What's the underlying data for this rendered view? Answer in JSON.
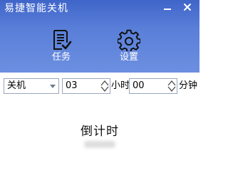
{
  "window": {
    "title": "易捷智能关机",
    "minimize_icon": "minimize-icon",
    "close_icon": "close-icon"
  },
  "toolbar": {
    "task": {
      "label": "任务",
      "icon": "task-list-icon"
    },
    "settings": {
      "label": "设置",
      "icon": "gear-icon"
    }
  },
  "controls": {
    "action_select": {
      "value": "关机"
    },
    "hours": {
      "value": "03",
      "unit": "小时"
    },
    "minutes": {
      "value": "00",
      "unit": "分钟"
    }
  },
  "countdown": {
    "title": "倒计时"
  },
  "colors": {
    "header_top": "#3f65c9",
    "header_bottom": "#6c8fe0",
    "border": "#9aa6b8"
  }
}
